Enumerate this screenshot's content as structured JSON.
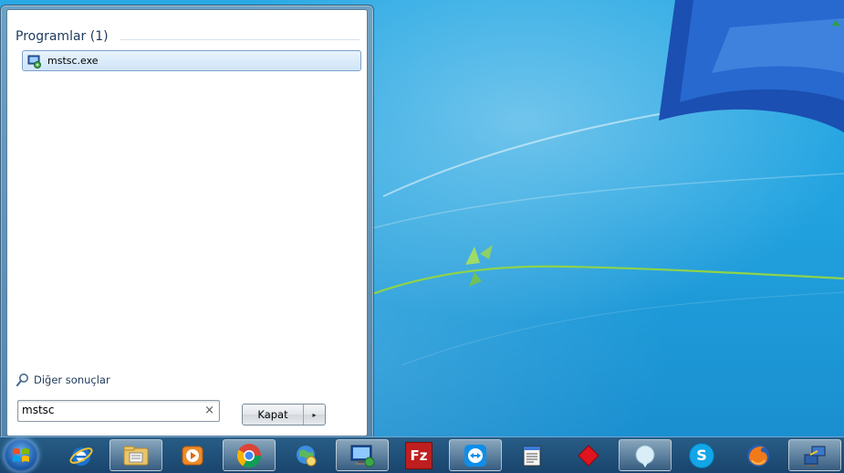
{
  "start_menu": {
    "group_title": "Programlar (1)",
    "results": [
      {
        "label": "mstsc.exe",
        "icon": "remote-desktop-icon"
      }
    ],
    "more_results": "Diğer sonuçlar",
    "search": {
      "value": "mstsc",
      "clear_glyph": "×"
    },
    "shutdown": {
      "label": "Kapat",
      "arrow_glyph": "▸"
    }
  },
  "taskbar": {
    "items": [
      {
        "name": "internet-explorer-icon"
      },
      {
        "name": "file-explorer-icon"
      },
      {
        "name": "media-player-icon"
      },
      {
        "name": "chrome-icon"
      },
      {
        "name": "network-globe-icon"
      },
      {
        "name": "remote-desktop-icon"
      },
      {
        "name": "filezilla-icon",
        "text": "Fz"
      },
      {
        "name": "teamviewer-icon"
      },
      {
        "name": "notepad-icon"
      },
      {
        "name": "red-diamond-icon"
      },
      {
        "name": "chat-bubble-icon"
      },
      {
        "name": "skype-icon",
        "text": "S"
      },
      {
        "name": "firefox-icon"
      },
      {
        "name": "network-connection-icon"
      }
    ]
  },
  "colors": {
    "desktop": "#22a3e0",
    "menu_title": "#1e395b",
    "selection": "#cfe4f8"
  }
}
